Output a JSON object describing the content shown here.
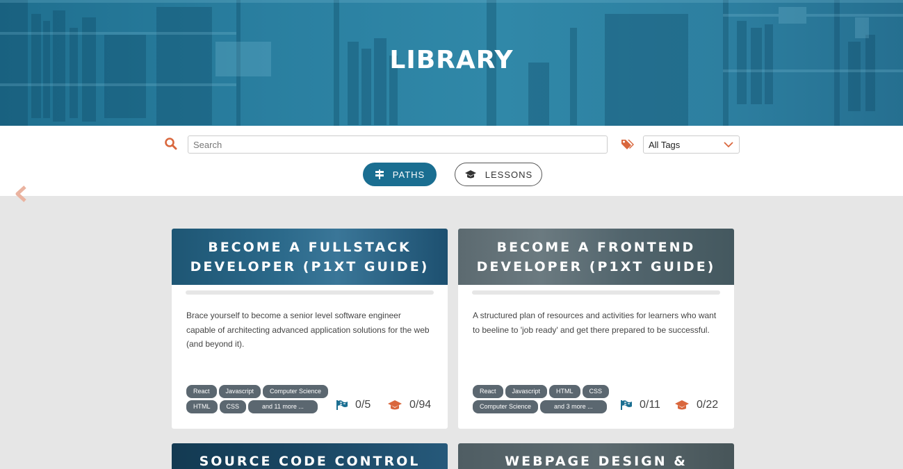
{
  "hero": {
    "title": "LIBRARY"
  },
  "search": {
    "placeholder": "Search",
    "value": ""
  },
  "tag_filter": {
    "selected": "All Tags"
  },
  "tabs": [
    {
      "label": "PATHS",
      "active": true
    },
    {
      "label": "LESSONS",
      "active": false
    }
  ],
  "colors": {
    "accent": "#1a6e91",
    "icon_orange": "#d9673d",
    "tag_bg": "#5b6770"
  },
  "cards": [
    {
      "title": "BECOME A FULLSTACK DEVELOPER (P1XT GUIDE)",
      "description": "Brace yourself to become a senior level software engineer capable of architecting advanced application solutions for the web (and beyond it).",
      "tags": [
        "React",
        "Javascript",
        "Computer Science",
        "HTML",
        "CSS",
        "and 11 more ..."
      ],
      "paths_progress": "0/5",
      "lessons_progress": "0/94"
    },
    {
      "title": "BECOME A FRONTEND DEVELOPER (P1XT GUIDE)",
      "description": "A structured plan of resources and activities for learners who want to beeline to 'job ready' and get there prepared to be successful.",
      "tags": [
        "React",
        "Javascript",
        "HTML",
        "CSS",
        "Computer Science",
        "and 3 more ..."
      ],
      "paths_progress": "0/11",
      "lessons_progress": "0/22"
    },
    {
      "title": "SOURCE CODE CONTROL"
    },
    {
      "title": "WEBPAGE DESIGN &"
    }
  ]
}
